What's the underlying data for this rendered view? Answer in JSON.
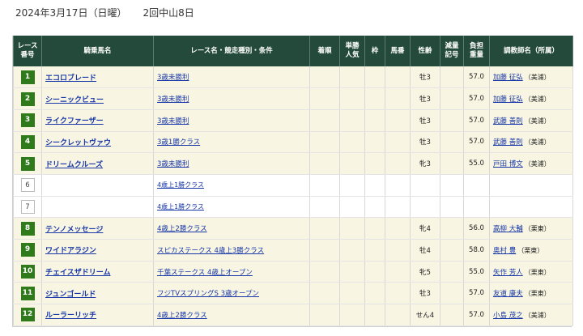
{
  "header": {
    "date": "2024年3月17日（日曜）",
    "meeting": "2回中山8日"
  },
  "table": {
    "columns": {
      "race_no": [
        "レース",
        "番号"
      ],
      "horse": "騎乗馬名",
      "race": "レース名・競走種別・条件",
      "finish": "着順",
      "odds": [
        "単勝",
        "人気"
      ],
      "waku": "枠",
      "umaban": "馬番",
      "sex_age": "性齢",
      "weight_mark": [
        "減量",
        "記号"
      ],
      "burden": [
        "負担",
        "重量"
      ],
      "trainer": "調教師名（所属）"
    },
    "rows": [
      {
        "no": "1",
        "horse": "エコロブレード",
        "race": "3歳未勝利",
        "sex_age": "牡3",
        "burden": "57.0",
        "trainer": "加藤 征弘",
        "aff": "（美浦）",
        "run": true
      },
      {
        "no": "2",
        "horse": "シーニックビュー",
        "race": "3歳未勝利",
        "sex_age": "牡3",
        "burden": "57.0",
        "trainer": "加藤 征弘",
        "aff": "（美浦）",
        "run": true
      },
      {
        "no": "3",
        "horse": "ライクファーザー",
        "race": "3歳未勝利",
        "sex_age": "牡3",
        "burden": "57.0",
        "trainer": "武藤 善則",
        "aff": "（美浦）",
        "run": true
      },
      {
        "no": "4",
        "horse": "シークレットヴァウ",
        "race": "3歳1勝クラス",
        "sex_age": "牡3",
        "burden": "57.0",
        "trainer": "武藤 善則",
        "aff": "（美浦）",
        "run": true
      },
      {
        "no": "5",
        "horse": "ドリームクルーズ",
        "race": "3歳未勝利",
        "sex_age": "牝3",
        "burden": "55.0",
        "trainer": "戸田 博文",
        "aff": "（美浦）",
        "run": true
      },
      {
        "no": "6",
        "horse": "",
        "race": "4歳上1勝クラス",
        "sex_age": "",
        "burden": "",
        "trainer": "",
        "aff": "",
        "run": false
      },
      {
        "no": "7",
        "horse": "",
        "race": "4歳上1勝クラス",
        "sex_age": "",
        "burden": "",
        "trainer": "",
        "aff": "",
        "run": false
      },
      {
        "no": "8",
        "horse": "テンノメッセージ",
        "race": "4歳上2勝クラス",
        "sex_age": "牝4",
        "burden": "56.0",
        "trainer": "高柳 大輔",
        "aff": "（栗東）",
        "run": true
      },
      {
        "no": "9",
        "horse": "ワイドアラジン",
        "race": "スピカステークス 4歳上3勝クラス",
        "sex_age": "牡4",
        "burden": "58.0",
        "trainer": "奥村 豊",
        "aff": "（栗東）",
        "run": true
      },
      {
        "no": "10",
        "horse": "チェイスザドリーム",
        "race": "千葉ステークス 4歳上オープン",
        "sex_age": "牝5",
        "burden": "55.0",
        "trainer": "矢作 芳人",
        "aff": "（栗東）",
        "run": true
      },
      {
        "no": "11",
        "horse": "ジュンゴールド",
        "race": "フジTVスプリングS 3歳オープン",
        "sex_age": "牡3",
        "burden": "57.0",
        "trainer": "友道 康夫",
        "aff": "（栗東）",
        "run": true
      },
      {
        "no": "12",
        "horse": "ルーラーリッチ",
        "race": "4歳上2勝クラス",
        "sex_age": "せん4",
        "burden": "57.0",
        "trainer": "小島 茂之",
        "aff": "（美浦）",
        "run": true
      }
    ]
  },
  "colors": {
    "header_bg": "#234a3a",
    "badge_green": "#2f7a1a",
    "row_bg": "#f8f6e2",
    "link": "#1736a8"
  }
}
